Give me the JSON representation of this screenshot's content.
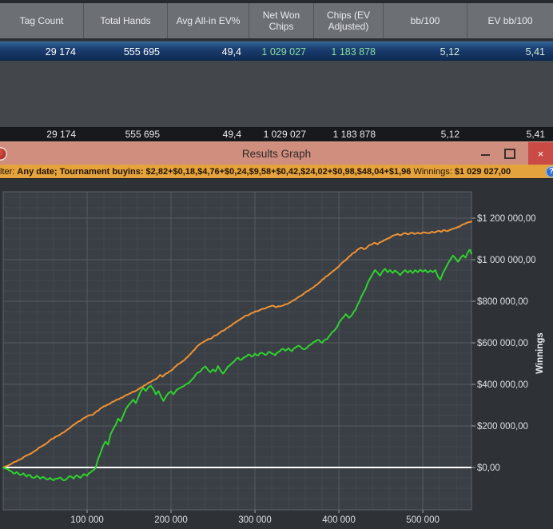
{
  "table": {
    "columns": [
      {
        "label": "Tag Count"
      },
      {
        "label": "Total Hands"
      },
      {
        "label": "Avg All-in EV%"
      },
      {
        "label": "Net Won Chips"
      },
      {
        "label": "Chips (EV Adjusted)"
      },
      {
        "label": "bb/100"
      },
      {
        "label": "EV bb/100"
      }
    ],
    "selected_row": {
      "cells": [
        "29 174",
        "555 695",
        "49,4",
        "1 029 027",
        "1 183 878",
        "5,12",
        "5,41"
      ]
    },
    "summary_row": {
      "cells": [
        "29 174",
        "555 695",
        "49,4",
        "1 029 027",
        "1 183 878",
        "5,12",
        "5,41"
      ]
    }
  },
  "window": {
    "title": "Results Graph",
    "close_glyph": "×"
  },
  "filter_bar": {
    "prefix": "lter:",
    "filters_bold": "Any date; Tournament buyins: $2,82+$0,18,$4,76+$0,24,$9,58+$0,42,$24,02+$0,98,$48,04+$1,96",
    "winnings_label": "Winnings:",
    "winnings_value": "$1 029 027,00",
    "help_glyph": "?"
  },
  "colors": {
    "chart_bg": "#2e3237",
    "plot_bg": "#3a3f45",
    "grid_minor": "#43474e",
    "grid_major": "#565b62",
    "plot_border": "#5d6269",
    "tick": "#9aa0a6",
    "zero_line": "#ffffff",
    "orange_line": "#ee9234",
    "green_line": "#2fd12f",
    "selected_row_blue": "#1a3c6e",
    "titlebar_salmon": "#d08e7e",
    "filter_orange": "#e4a33c"
  },
  "chart_data": {
    "type": "line",
    "title": "Results Graph",
    "xlabel": "",
    "ylabel": "Winnings",
    "x_unit": "hands",
    "x_max": 558000,
    "y_min": -204000,
    "y_max": 1327000,
    "grid": true,
    "legend": "none",
    "x_minor_step": 20000,
    "y_minor_step": 50000,
    "x_ticks": [
      100000,
      200000,
      300000,
      400000,
      500000
    ],
    "x_tick_labels": [
      "100 000",
      "200 000",
      "300 000",
      "400 000",
      "500 000"
    ],
    "y_ticks": [
      0,
      200000,
      400000,
      600000,
      800000,
      1000000,
      1200000
    ],
    "y_tick_labels": [
      "$0,00",
      "$200 000,00",
      "$400 000,00",
      "$600 000,00",
      "$800 000,00",
      "$1 000 000,00",
      "$1 200 000,00"
    ],
    "zero_line": true,
    "units_note": "series points are [hands_thousands, dollars_thousands]",
    "series": [
      {
        "name": "Chips (EV Adjusted)",
        "color": "#ee9234",
        "final_value": 1183878,
        "points_k": [
          [
            0,
            0
          ],
          [
            5,
            8
          ],
          [
            10,
            18
          ],
          [
            15,
            28
          ],
          [
            20,
            38
          ],
          [
            25,
            52
          ],
          [
            30,
            62
          ],
          [
            35,
            72
          ],
          [
            40,
            85
          ],
          [
            45,
            100
          ],
          [
            50,
            112
          ],
          [
            55,
            128
          ],
          [
            60,
            140
          ],
          [
            65,
            152
          ],
          [
            70,
            165
          ],
          [
            75,
            178
          ],
          [
            80,
            192
          ],
          [
            85,
            208
          ],
          [
            90,
            222
          ],
          [
            95,
            235
          ],
          [
            100,
            246
          ],
          [
            104,
            252
          ],
          [
            108,
            258
          ],
          [
            112,
            272
          ],
          [
            116,
            285
          ],
          [
            120,
            295
          ],
          [
            124,
            302
          ],
          [
            128,
            310
          ],
          [
            132,
            318
          ],
          [
            136,
            328
          ],
          [
            140,
            335
          ],
          [
            144,
            342
          ],
          [
            148,
            350
          ],
          [
            152,
            358
          ],
          [
            156,
            365
          ],
          [
            160,
            374
          ],
          [
            164,
            385
          ],
          [
            168,
            395
          ],
          [
            172,
            405
          ],
          [
            176,
            412
          ],
          [
            180,
            422
          ],
          [
            184,
            432
          ],
          [
            187,
            445
          ],
          [
            190,
            437
          ],
          [
            194,
            452
          ],
          [
            198,
            462
          ],
          [
            202,
            472
          ],
          [
            206,
            488
          ],
          [
            210,
            500
          ],
          [
            214,
            512
          ],
          [
            218,
            526
          ],
          [
            222,
            542
          ],
          [
            226,
            560
          ],
          [
            230,
            578
          ],
          [
            234,
            592
          ],
          [
            238,
            602
          ],
          [
            242,
            612
          ],
          [
            246,
            618
          ],
          [
            250,
            628
          ],
          [
            254,
            636
          ],
          [
            258,
            648
          ],
          [
            262,
            658
          ],
          [
            266,
            670
          ],
          [
            270,
            680
          ],
          [
            274,
            692
          ],
          [
            278,
            702
          ],
          [
            282,
            712
          ],
          [
            286,
            722
          ],
          [
            290,
            732
          ],
          [
            294,
            738
          ],
          [
            298,
            745
          ],
          [
            302,
            752
          ],
          [
            306,
            758
          ],
          [
            310,
            764
          ],
          [
            314,
            770
          ],
          [
            318,
            775
          ],
          [
            322,
            778
          ],
          [
            326,
            772
          ],
          [
            330,
            775
          ],
          [
            334,
            780
          ],
          [
            338,
            786
          ],
          [
            342,
            795
          ],
          [
            346,
            805
          ],
          [
            350,
            815
          ],
          [
            354,
            825
          ],
          [
            358,
            836
          ],
          [
            362,
            848
          ],
          [
            366,
            858
          ],
          [
            370,
            868
          ],
          [
            374,
            880
          ],
          [
            378,
            894
          ],
          [
            382,
            908
          ],
          [
            386,
            922
          ],
          [
            390,
            935
          ],
          [
            394,
            948
          ],
          [
            398,
            962
          ],
          [
            402,
            978
          ],
          [
            406,
            992
          ],
          [
            410,
            1006
          ],
          [
            414,
            1020
          ],
          [
            418,
            1034
          ],
          [
            422,
            1048
          ],
          [
            426,
            1058
          ],
          [
            430,
            1050
          ],
          [
            434,
            1062
          ],
          [
            438,
            1072
          ],
          [
            442,
            1082
          ],
          [
            446,
            1074
          ],
          [
            450,
            1086
          ],
          [
            454,
            1094
          ],
          [
            458,
            1102
          ],
          [
            462,
            1110
          ],
          [
            466,
            1118
          ],
          [
            470,
            1124
          ],
          [
            474,
            1118
          ],
          [
            478,
            1128
          ],
          [
            482,
            1122
          ],
          [
            486,
            1130
          ],
          [
            490,
            1124
          ],
          [
            494,
            1130
          ],
          [
            498,
            1126
          ],
          [
            502,
            1132
          ],
          [
            506,
            1128
          ],
          [
            510,
            1134
          ],
          [
            514,
            1130
          ],
          [
            518,
            1138
          ],
          [
            522,
            1134
          ],
          [
            526,
            1142
          ],
          [
            530,
            1138
          ],
          [
            534,
            1146
          ],
          [
            538,
            1152
          ],
          [
            542,
            1158
          ],
          [
            546,
            1166
          ],
          [
            550,
            1172
          ],
          [
            554,
            1180
          ],
          [
            558,
            1184
          ]
        ]
      },
      {
        "name": "Net Won Chips",
        "color": "#2fd12f",
        "final_value": 1029027,
        "points_k": [
          [
            0,
            0
          ],
          [
            4,
            -6
          ],
          [
            8,
            -16
          ],
          [
            12,
            -28
          ],
          [
            16,
            -22
          ],
          [
            20,
            -36
          ],
          [
            24,
            -28
          ],
          [
            28,
            -44
          ],
          [
            32,
            -36
          ],
          [
            36,
            -50
          ],
          [
            40,
            -40
          ],
          [
            44,
            -54
          ],
          [
            48,
            -46
          ],
          [
            52,
            -58
          ],
          [
            56,
            -50
          ],
          [
            60,
            -62
          ],
          [
            64,
            -54
          ],
          [
            68,
            -48
          ],
          [
            72,
            -62
          ],
          [
            76,
            -54
          ],
          [
            80,
            -42
          ],
          [
            84,
            -54
          ],
          [
            88,
            -38
          ],
          [
            92,
            -50
          ],
          [
            96,
            -32
          ],
          [
            100,
            -40
          ],
          [
            104,
            -24
          ],
          [
            108,
            -12
          ],
          [
            110,
            -4
          ],
          [
            113,
            40
          ],
          [
            116,
            70
          ],
          [
            119,
            105
          ],
          [
            122,
            125
          ],
          [
            125,
            110
          ],
          [
            128,
            160
          ],
          [
            131,
            185
          ],
          [
            134,
            205
          ],
          [
            137,
            235
          ],
          [
            140,
            222
          ],
          [
            143,
            250
          ],
          [
            146,
            280
          ],
          [
            149,
            298
          ],
          [
            152,
            312
          ],
          [
            155,
            326
          ],
          [
            158,
            310
          ],
          [
            161,
            338
          ],
          [
            164,
            368
          ],
          [
            167,
            382
          ],
          [
            170,
            368
          ],
          [
            173,
            386
          ],
          [
            176,
            394
          ],
          [
            179,
            376
          ],
          [
            182,
            352
          ],
          [
            185,
            368
          ],
          [
            188,
            342
          ],
          [
            191,
            320
          ],
          [
            194,
            342
          ],
          [
            197,
            358
          ],
          [
            200,
            366
          ],
          [
            203,
            352
          ],
          [
            206,
            370
          ],
          [
            209,
            380
          ],
          [
            213,
            388
          ],
          [
            217,
            398
          ],
          [
            221,
            406
          ],
          [
            225,
            424
          ],
          [
            229,
            444
          ],
          [
            233,
            458
          ],
          [
            237,
            474
          ],
          [
            241,
            486
          ],
          [
            244,
            470
          ],
          [
            247,
            458
          ],
          [
            250,
            472
          ],
          [
            253,
            462
          ],
          [
            256,
            488
          ],
          [
            259,
            466
          ],
          [
            262,
            452
          ],
          [
            265,
            468
          ],
          [
            268,
            486
          ],
          [
            272,
            500
          ],
          [
            276,
            514
          ],
          [
            280,
            528
          ],
          [
            284,
            518
          ],
          [
            288,
            532
          ],
          [
            292,
            544
          ],
          [
            296,
            534
          ],
          [
            300,
            548
          ],
          [
            304,
            540
          ],
          [
            308,
            552
          ],
          [
            312,
            542
          ],
          [
            316,
            556
          ],
          [
            320,
            548
          ],
          [
            324,
            540
          ],
          [
            328,
            556
          ],
          [
            332,
            570
          ],
          [
            336,
            562
          ],
          [
            340,
            574
          ],
          [
            344,
            560
          ],
          [
            348,
            576
          ],
          [
            352,
            586
          ],
          [
            356,
            574
          ],
          [
            360,
            570
          ],
          [
            364,
            586
          ],
          [
            368,
            596
          ],
          [
            372,
            606
          ],
          [
            376,
            614
          ],
          [
            380,
            600
          ],
          [
            384,
            616
          ],
          [
            388,
            630
          ],
          [
            392,
            652
          ],
          [
            396,
            666
          ],
          [
            400,
            696
          ],
          [
            404,
            718
          ],
          [
            408,
            738
          ],
          [
            412,
            720
          ],
          [
            416,
            736
          ],
          [
            420,
            760
          ],
          [
            424,
            796
          ],
          [
            428,
            832
          ],
          [
            432,
            862
          ],
          [
            436,
            902
          ],
          [
            440,
            930
          ],
          [
            443,
            950
          ],
          [
            446,
            938
          ],
          [
            449,
            924
          ],
          [
            452,
            944
          ],
          [
            455,
            956
          ],
          [
            458,
            940
          ],
          [
            461,
            950
          ],
          [
            464,
            936
          ],
          [
            467,
            948
          ],
          [
            470,
            938
          ],
          [
            473,
            926
          ],
          [
            476,
            940
          ],
          [
            479,
            950
          ],
          [
            482,
            938
          ],
          [
            485,
            948
          ],
          [
            488,
            936
          ],
          [
            491,
            950
          ],
          [
            494,
            940
          ],
          [
            497,
            952
          ],
          [
            500,
            942
          ],
          [
            503,
            950
          ],
          [
            506,
            938
          ],
          [
            509,
            948
          ],
          [
            512,
            940
          ],
          [
            515,
            950
          ],
          [
            518,
            918
          ],
          [
            521,
            904
          ],
          [
            524,
            936
          ],
          [
            527,
            958
          ],
          [
            530,
            982
          ],
          [
            533,
            1002
          ],
          [
            536,
            1020
          ],
          [
            539,
            1006
          ],
          [
            542,
            990
          ],
          [
            545,
            1008
          ],
          [
            548,
            1022
          ],
          [
            551,
            1010
          ],
          [
            554,
            1038
          ],
          [
            556,
            1048
          ],
          [
            558,
            1029
          ]
        ]
      }
    ]
  }
}
